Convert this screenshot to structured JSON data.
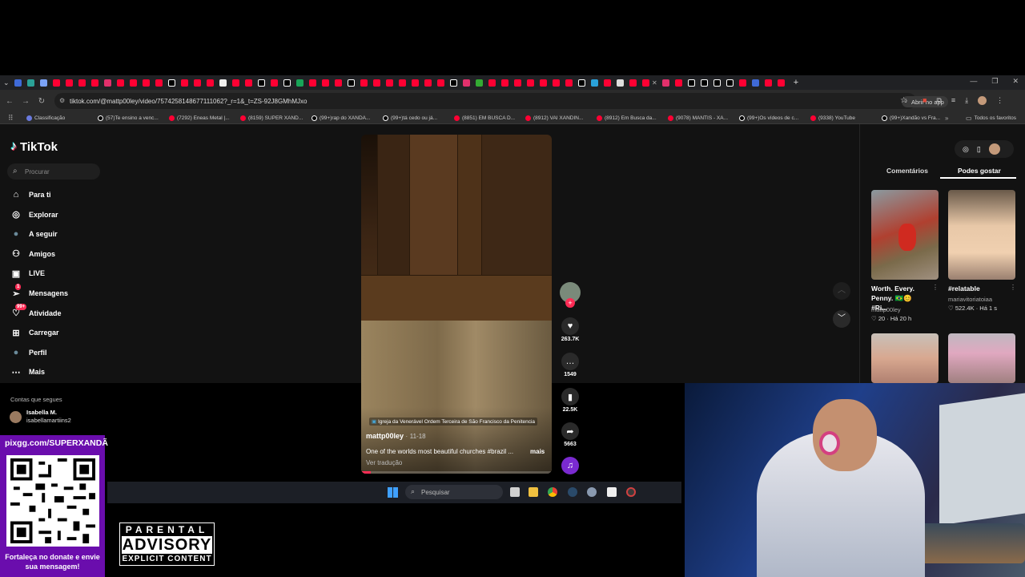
{
  "browser": {
    "url": "tiktok.com/@mattp00ley/video/7574258148677111062?_r=1&_t=ZS-92J8GMhMJxo",
    "open_app_label": "Abrir no app",
    "all_favorites_label": "Todos os favoritos",
    "bookmarks": [
      {
        "label": "Classificação",
        "icon": "globe-icon"
      },
      {
        "label": "(57)Te ensino a venc...",
        "icon": "tiktok-icon"
      },
      {
        "label": "(7292) Eneas Metal |...",
        "icon": "youtube-icon"
      },
      {
        "label": "(8159) SUPER XAND...",
        "icon": "youtube-icon"
      },
      {
        "label": "(99+)rap do XANDÃ...",
        "icon": "tiktok-icon"
      },
      {
        "label": "(99+)tá cedo ou já...",
        "icon": "tiktok-icon"
      },
      {
        "label": "(8851) EM BUSCA D...",
        "icon": "youtube-icon"
      },
      {
        "label": "(8912) VAI XANDIN...",
        "icon": "youtube-icon"
      },
      {
        "label": "(8912) Em Busca da...",
        "icon": "youtube-icon"
      },
      {
        "label": "(9078) MANTIS - XA...",
        "icon": "youtube-icon"
      },
      {
        "label": "(99+)Os vídeos de c...",
        "icon": "tiktok-icon"
      },
      {
        "label": "(9338) YouTube",
        "icon": "youtube-icon"
      },
      {
        "label": "(99+)Xandão vs Fra...",
        "icon": "tiktok-icon"
      }
    ]
  },
  "tiktok": {
    "logo": "TikTok",
    "search_placeholder": "Procurar",
    "nav": [
      {
        "label": "Para ti",
        "icon": "home-icon"
      },
      {
        "label": "Explorar",
        "icon": "compass-icon"
      },
      {
        "label": "A seguir",
        "icon": "following-icon"
      },
      {
        "label": "Amigos",
        "icon": "friends-icon"
      },
      {
        "label": "LIVE",
        "icon": "live-icon"
      },
      {
        "label": "Mensagens",
        "icon": "messages-icon",
        "badge": "1"
      },
      {
        "label": "Atividade",
        "icon": "activity-icon",
        "badge": "99+"
      },
      {
        "label": "Carregar",
        "icon": "upload-icon"
      },
      {
        "label": "Perfil",
        "icon": "profile-icon"
      },
      {
        "label": "Mais",
        "icon": "more-icon"
      }
    ],
    "following_heading": "Contas que segues",
    "followed_account": {
      "name": "Isabella M.",
      "handle": "isabellamartiins2"
    },
    "video": {
      "location": "Igreja da Venerável Ordem Terceira de São Francisco da Penitencia",
      "author": "mattp00ley",
      "date": "11-18",
      "caption": "One of the worlds most beautiful churches #brazil ...",
      "more_label": "mais",
      "translate_label": "Ver tradução",
      "likes": "263.7K",
      "comments": "1549",
      "saves": "22.5K",
      "shares": "5663"
    },
    "right_tabs": [
      "Comentários",
      "Podes gostar"
    ],
    "suggestions": [
      {
        "title": "Worth. Every. Penny. 🇧🇷😊 #Ri...",
        "user": "mattp00ley",
        "likes": "20",
        "age": "Há 20 h"
      },
      {
        "title": "#relatable",
        "user": "mariavitoriatoiaa",
        "likes": "522.4K",
        "age": "Há 1 s"
      }
    ]
  },
  "taskbar": {
    "search_placeholder": "Pesquisar"
  },
  "overlay": {
    "qr_title": "pixgg.com/SUPERXANDÃ",
    "qr_caption": "Fortaleça no donate e envie sua mensagem!",
    "advisory": [
      "PARENTAL",
      "ADVISORY",
      "EXPLICIT CONTENT"
    ]
  },
  "colors": {
    "tiktok_red": "#fe2c55",
    "accent_purple": "#6a0dad"
  }
}
